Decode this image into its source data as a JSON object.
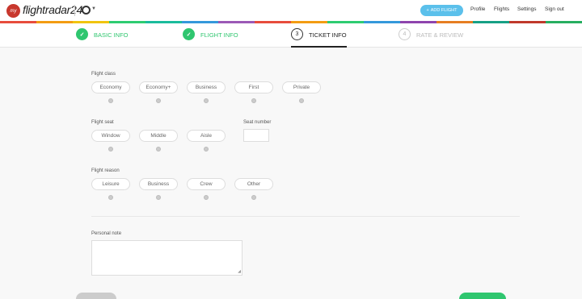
{
  "header": {
    "logo_badge": "my",
    "logo_text": "flightradar24",
    "add_flight": "ADD FLIGHT",
    "nav": [
      "Profile",
      "Flights",
      "Settings",
      "Sign out"
    ]
  },
  "stripe_colors": [
    "#e74c3c",
    "#f39c12",
    "#f1c40f",
    "#2ecc71",
    "#1abc9c",
    "#3498db",
    "#9b59b6",
    "#e74c3c",
    "#f39c12",
    "#2ecc71",
    "#3498db",
    "#8e44ad",
    "#e67e22",
    "#16a085",
    "#c0392b",
    "#27ae60"
  ],
  "steps": [
    {
      "marker": "✓",
      "label": "BASIC INFO",
      "state": "done"
    },
    {
      "marker": "✓",
      "label": "FLIGHT INFO",
      "state": "done"
    },
    {
      "marker": "3",
      "label": "TICKET INFO",
      "state": "current"
    },
    {
      "marker": "4",
      "label": "RATE & REVIEW",
      "state": "todo"
    }
  ],
  "form": {
    "flight_class": {
      "label": "Flight class",
      "options": [
        "Economy",
        "Economy+",
        "Business",
        "First",
        "Private"
      ]
    },
    "flight_seat": {
      "label": "Flight seat",
      "options": [
        "Window",
        "Middle",
        "Aisle"
      ]
    },
    "seat_number": {
      "label": "Seat number",
      "value": ""
    },
    "flight_reason": {
      "label": "Flight reason",
      "options": [
        "Leisure",
        "Business",
        "Crew",
        "Other"
      ]
    },
    "personal_note": {
      "label": "Personal note",
      "value": ""
    }
  }
}
